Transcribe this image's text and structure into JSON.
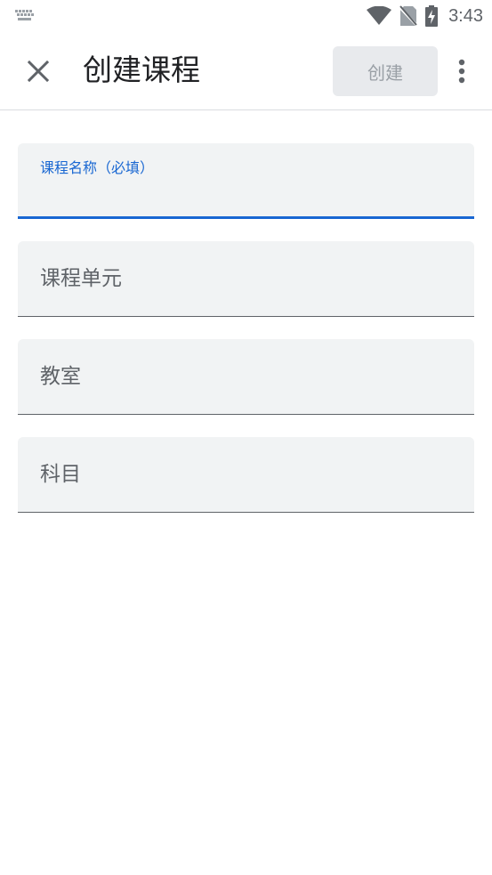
{
  "status_bar": {
    "time": "3:43",
    "icons": [
      "keyboard-icon",
      "wifi-icon",
      "no-sim-icon",
      "battery-charging-icon"
    ]
  },
  "app_bar": {
    "close_icon": "close-icon",
    "title": "创建课程",
    "create_label": "创建",
    "more_icon": "more-vert-icon"
  },
  "form": {
    "course_name": {
      "label": "课程名称（必填）",
      "value": ""
    },
    "section": {
      "label": "课程单元"
    },
    "room": {
      "label": "教室"
    },
    "subject": {
      "label": "科目"
    }
  },
  "colors": {
    "accent": "#1967d2",
    "field_bg": "#f1f3f4",
    "button_disabled_bg": "#e8eaed",
    "button_disabled_text": "#9aa0a6"
  }
}
